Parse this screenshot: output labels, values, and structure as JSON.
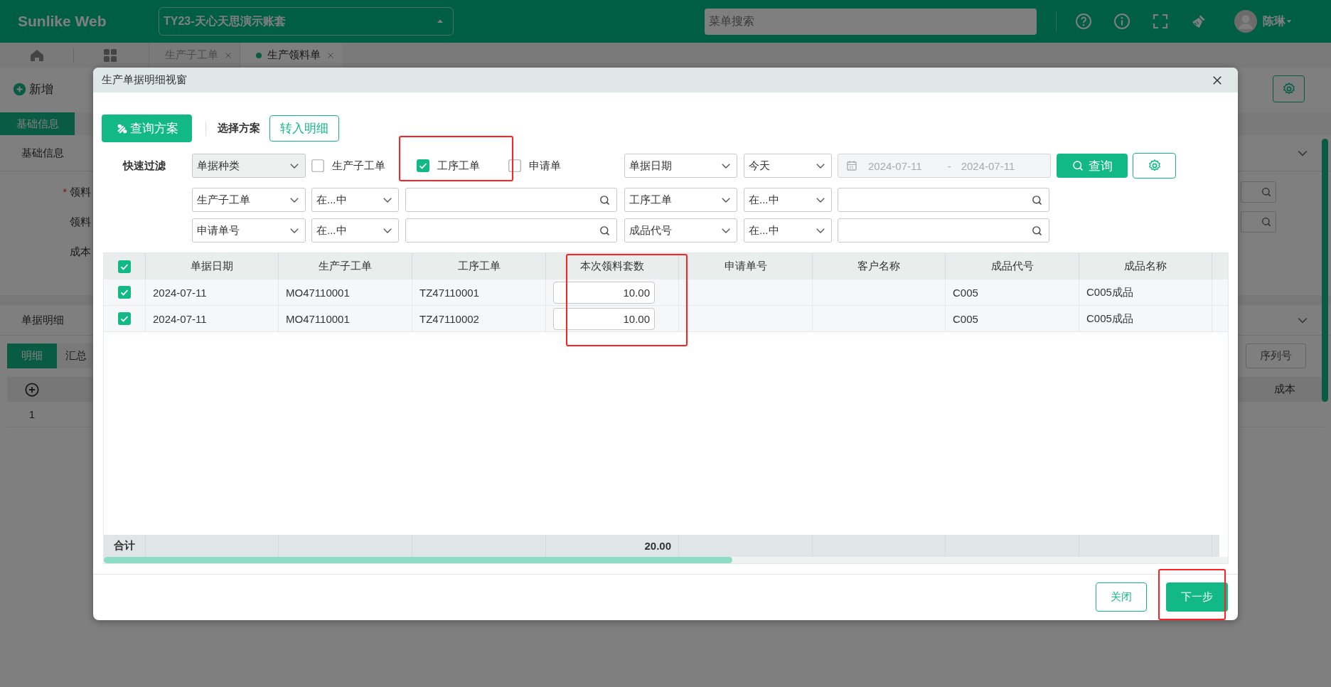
{
  "app": {
    "logo": "Sunlike Web",
    "account": "TY23-天心天思演示账套",
    "menu_search": {
      "placeholder": "菜单搜索"
    },
    "user": "陈琳"
  },
  "page_tabs": [
    {
      "label": "生产子工单",
      "selected": false
    },
    {
      "label": "生产领料单",
      "selected": true
    }
  ],
  "toolbar": {
    "new_button": "新增"
  },
  "form_tabs": [
    {
      "label": "基础信息",
      "selected": true
    }
  ],
  "basic_section": {
    "title": "基础信息",
    "fields": [
      {
        "label": "领料",
        "required_mark": "*",
        "kind": "lookup"
      },
      {
        "label": "领料",
        "kind": "lookup"
      },
      {
        "label": "成本",
        "kind": "plain"
      }
    ]
  },
  "detail_section": {
    "title": "单据明细",
    "tabs": [
      {
        "label": "明细",
        "selected": true
      },
      {
        "label": "汇总",
        "selected": false
      }
    ],
    "serial_button": "序列号",
    "grid": {
      "column": "成本",
      "rows": [
        "1"
      ]
    }
  },
  "dialog": {
    "title": "生产单据明细视窗",
    "scheme_button": "查询方案",
    "scheme_label": "选择方案",
    "transfer_button": "转入明细",
    "quick_filter": {
      "label": "快速过滤",
      "type_select": "单据种类",
      "options": [
        {
          "label": "生产子工单",
          "checked": false,
          "highlighted": false
        },
        {
          "label": "工序工单",
          "checked": true,
          "highlighted": true
        },
        {
          "label": "申请单",
          "checked": false,
          "highlighted": false
        }
      ],
      "date_select": "单据日期",
      "date_preset": "今天",
      "date_from": "2024-07-11",
      "date_separator": "-",
      "date_to": "2024-07-11",
      "search_button": "查询"
    },
    "conditions": [
      {
        "field": "生产子工单",
        "operator": "在...中"
      },
      {
        "field": "工序工单",
        "operator": "在...中"
      },
      {
        "field": "申请单号",
        "operator": "在...中"
      },
      {
        "field": "成品代号",
        "operator": "在...中"
      }
    ],
    "table": {
      "all_selected": true,
      "columns": [
        {
          "label": "单据日期",
          "kind": "text",
          "highlighted": false
        },
        {
          "label": "生产子工单",
          "kind": "text",
          "highlighted": false
        },
        {
          "label": "工序工单",
          "kind": "text",
          "highlighted": false
        },
        {
          "label": "本次领料套数",
          "kind": "input",
          "highlighted": true,
          "total": "20.00"
        },
        {
          "label": "申请单号",
          "kind": "text",
          "highlighted": false
        },
        {
          "label": "客户名称",
          "kind": "text",
          "highlighted": false
        },
        {
          "label": "成品代号",
          "kind": "text",
          "highlighted": false
        },
        {
          "label": "成品名称",
          "kind": "text",
          "highlighted": false
        }
      ],
      "rows": [
        {
          "selected": true,
          "cells": [
            "2024-07-11",
            "MO47110001",
            "TZ47110001",
            "10.00",
            null,
            null,
            "C005",
            "C005成品"
          ]
        },
        {
          "selected": true,
          "cells": [
            "2024-07-11",
            "MO47110001",
            "TZ47110002",
            "10.00",
            null,
            null,
            "C005",
            "C005成品"
          ]
        }
      ],
      "total_label": "合计"
    },
    "close_button": "关闭",
    "next_button": {
      "label": "下一步",
      "highlighted": true
    }
  }
}
